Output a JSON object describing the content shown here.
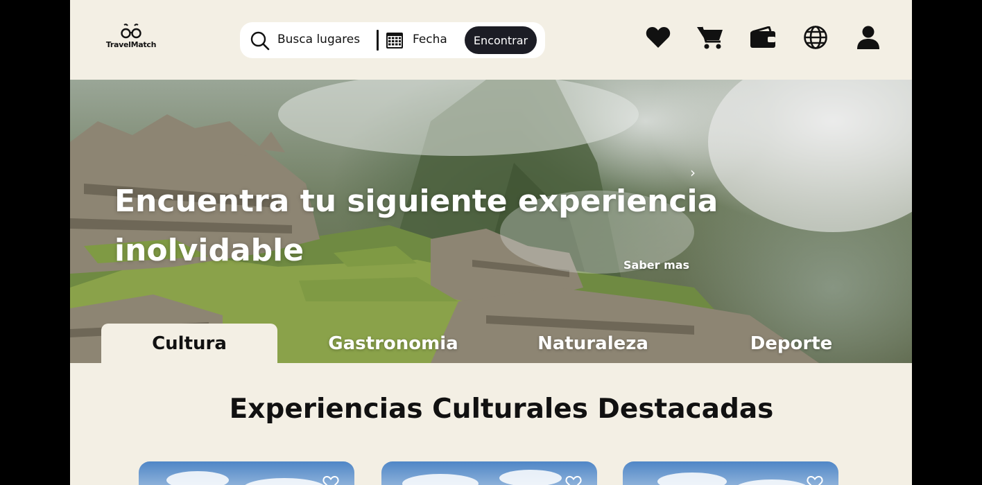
{
  "app": {
    "brand": "TravelMatch"
  },
  "search": {
    "placeholder": "Busca lugares",
    "date_label": "Fecha",
    "find_button": "Encontrar"
  },
  "nav_icons": [
    "heart-icon",
    "cart-icon",
    "wallet-icon",
    "globe-icon",
    "user-icon"
  ],
  "hero": {
    "title": "Encuentra tu siguiente experiencia inolvidable",
    "cta": "Saber mas",
    "next_glyph": "›"
  },
  "tabs": [
    {
      "label": "Cultura",
      "active": true
    },
    {
      "label": "Gastronomia",
      "active": false
    },
    {
      "label": "Naturaleza",
      "active": false
    },
    {
      "label": "Deporte",
      "active": false
    }
  ],
  "section": {
    "title": "Experiencias Culturales Destacadas"
  },
  "cards_count_visible": 3,
  "colors": {
    "background": "#f3efe4",
    "button_dark": "#1c1d25",
    "text": "#111111"
  }
}
